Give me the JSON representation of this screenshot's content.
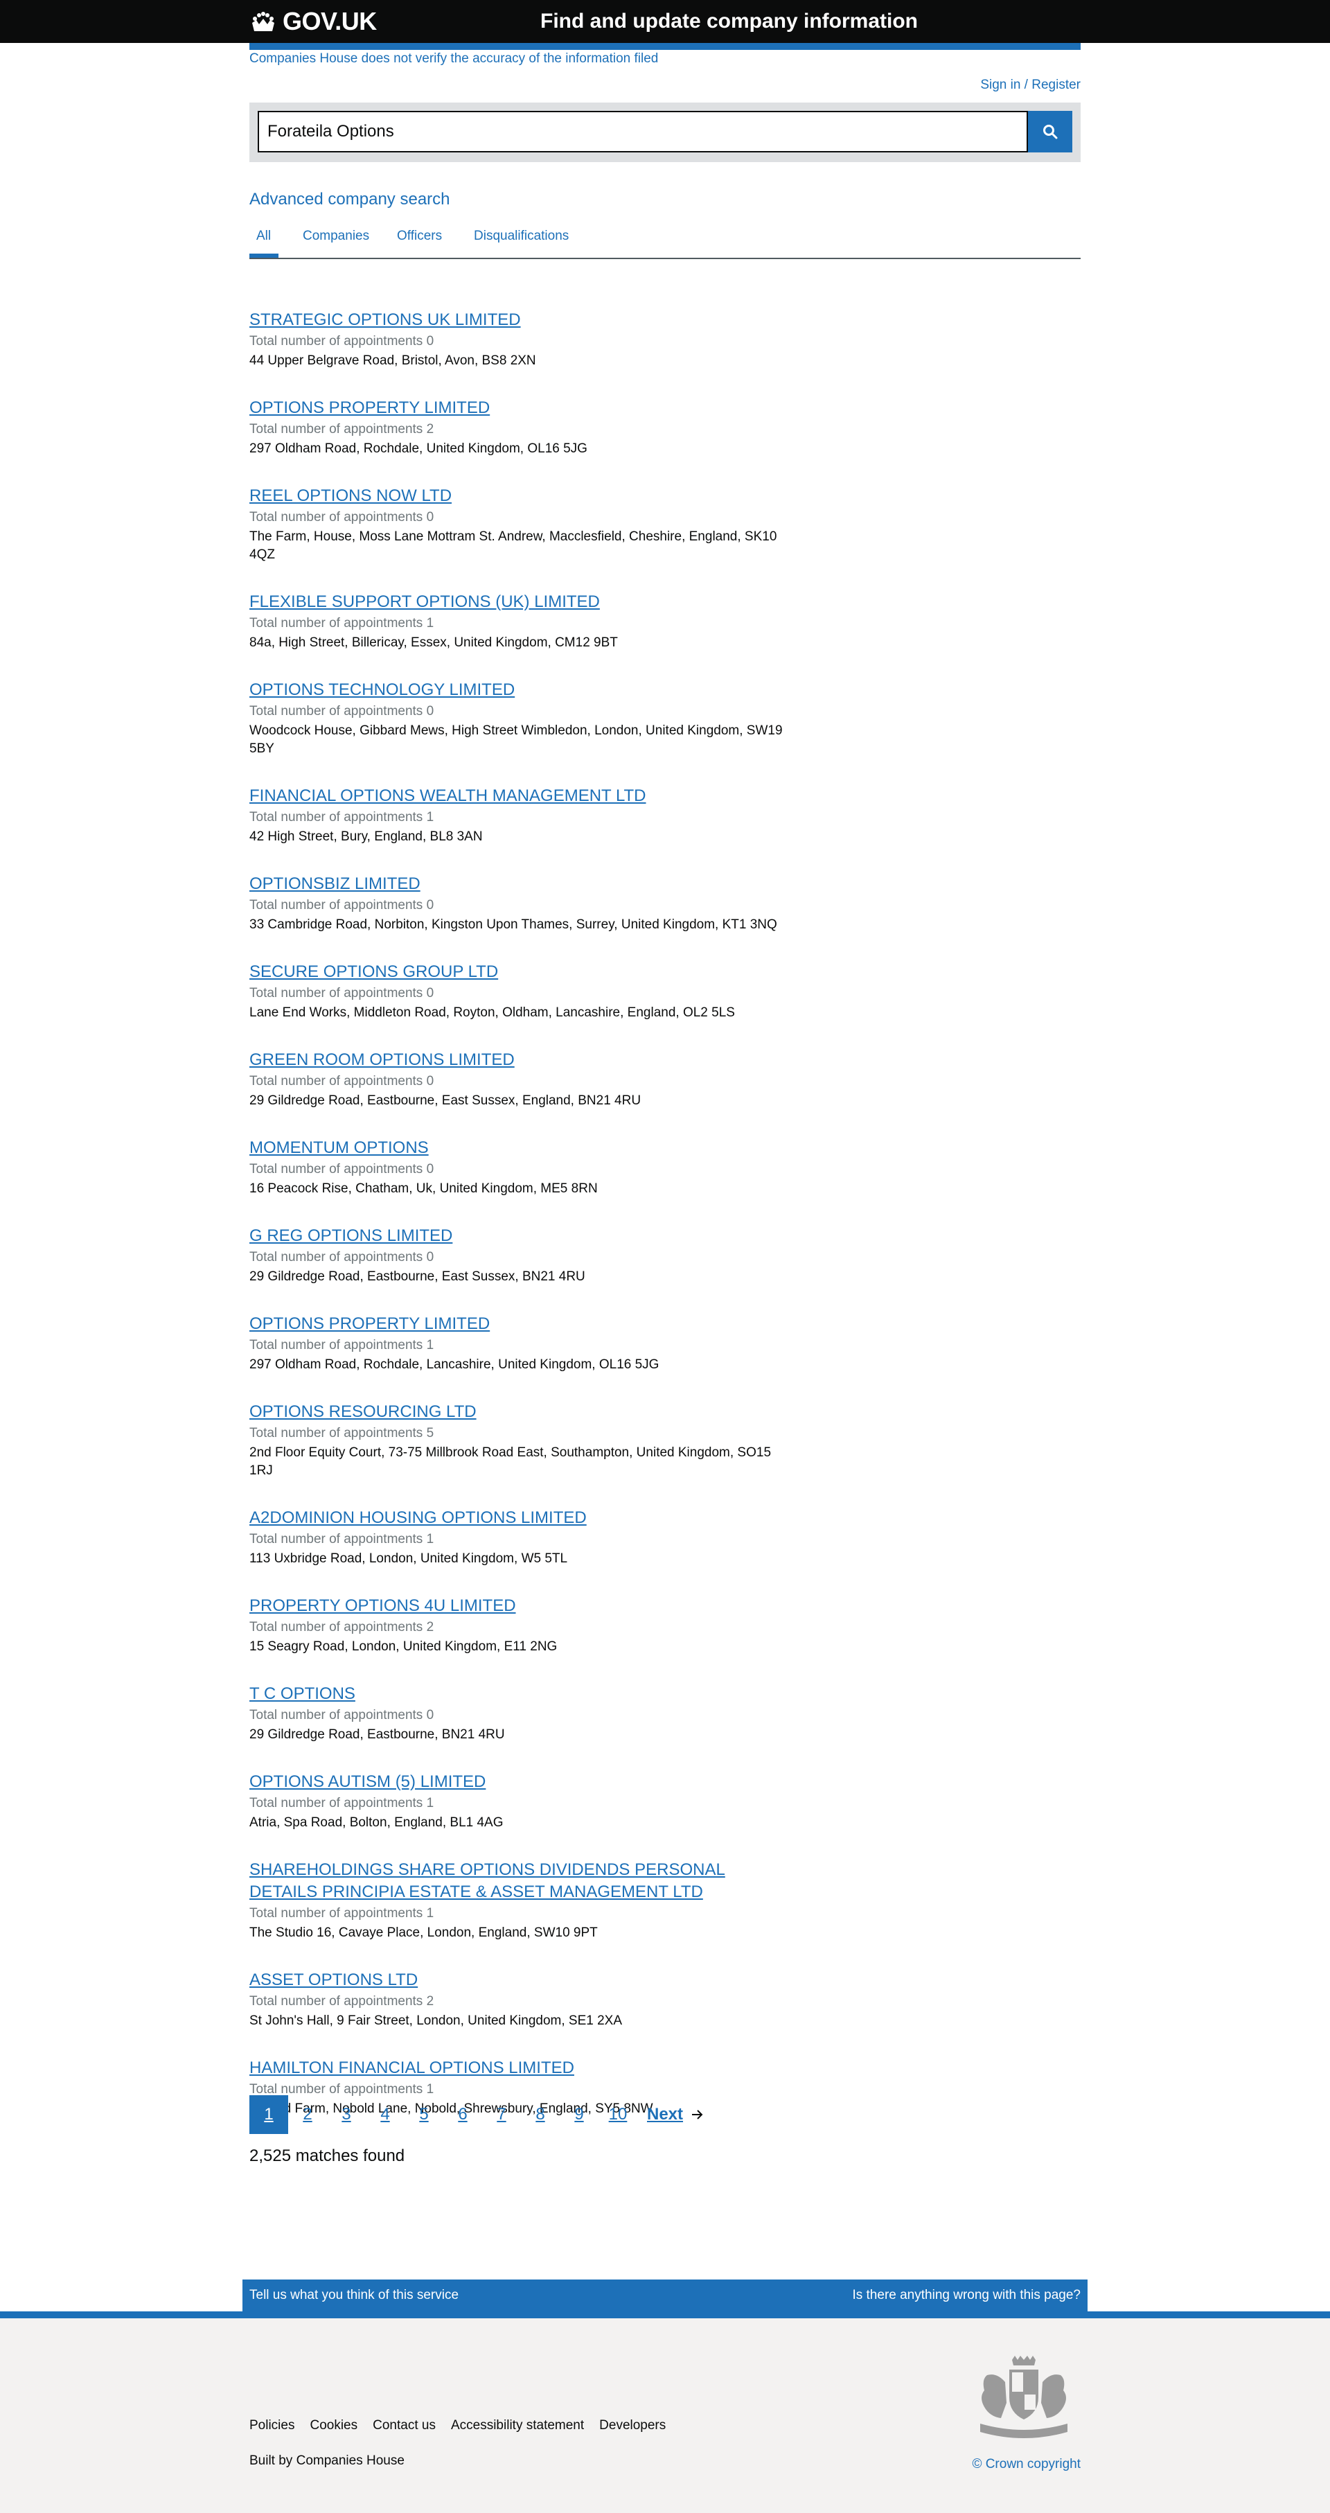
{
  "header": {
    "logo_text": "GOV.UK",
    "service_name": "Find and update company information"
  },
  "disclaimer": "Companies House does not verify the accuracy of the information filed",
  "sign_in": "Sign in / Register",
  "search": {
    "value": "Forateila Options"
  },
  "advanced_search": "Advanced company search",
  "tabs": [
    {
      "label": "All",
      "active": true
    },
    {
      "label": "Companies"
    },
    {
      "label": "Officers"
    },
    {
      "label": "Disqualifications"
    }
  ],
  "results": [
    {
      "name": "STRATEGIC OPTIONS UK LIMITED",
      "appointments": "Total number of appointments 0",
      "address": "44 Upper Belgrave Road, Bristol, Avon, BS8 2XN"
    },
    {
      "name": "OPTIONS PROPERTY LIMITED",
      "appointments": "Total number of appointments 2",
      "address": "297 Oldham Road, Rochdale, United Kingdom, OL16 5JG"
    },
    {
      "name": "REEL OPTIONS NOW LTD",
      "appointments": "Total number of appointments 0",
      "address": "The Farm, House, Moss Lane Mottram St. Andrew, Macclesfield, Cheshire, England, SK10 4QZ"
    },
    {
      "name": "FLEXIBLE SUPPORT OPTIONS (UK) LIMITED",
      "appointments": "Total number of appointments 1",
      "address": "84a, High Street, Billericay, Essex, United Kingdom, CM12 9BT"
    },
    {
      "name": "OPTIONS TECHNOLOGY LIMITED",
      "appointments": "Total number of appointments 0",
      "address": "Woodcock House, Gibbard Mews, High Street Wimbledon, London, United Kingdom, SW19 5BY"
    },
    {
      "name": "FINANCIAL OPTIONS WEALTH MANAGEMENT LTD",
      "appointments": "Total number of appointments 1",
      "address": "42 High Street, Bury, England, BL8 3AN"
    },
    {
      "name": "OPTIONSBIZ LIMITED",
      "appointments": "Total number of appointments 0",
      "address": "33 Cambridge Road, Norbiton, Kingston Upon Thames, Surrey, United Kingdom, KT1 3NQ"
    },
    {
      "name": "SECURE OPTIONS GROUP LTD",
      "appointments": "Total number of appointments 0",
      "address": "Lane End Works, Middleton Road, Royton, Oldham, Lancashire, England, OL2 5LS"
    },
    {
      "name": "GREEN ROOM OPTIONS LIMITED",
      "appointments": "Total number of appointments 0",
      "address": "29 Gildredge Road, Eastbourne, East Sussex, England, BN21 4RU"
    },
    {
      "name": "MOMENTUM OPTIONS",
      "appointments": "Total number of appointments 0",
      "address": "16 Peacock Rise, Chatham, Uk, United Kingdom, ME5 8RN"
    },
    {
      "name": "G REG OPTIONS LIMITED",
      "appointments": "Total number of appointments 0",
      "address": "29 Gildredge Road, Eastbourne, East Sussex, BN21 4RU"
    },
    {
      "name": "OPTIONS PROPERTY LIMITED",
      "appointments": "Total number of appointments 1",
      "address": "297 Oldham Road, Rochdale, Lancashire, United Kingdom, OL16 5JG"
    },
    {
      "name": "OPTIONS RESOURCING LTD",
      "appointments": "Total number of appointments 5",
      "address": "2nd Floor Equity Court, 73-75 Millbrook Road East, Southampton, United Kingdom, SO15 1RJ"
    },
    {
      "name": "A2DOMINION HOUSING OPTIONS LIMITED",
      "appointments": "Total number of appointments 1",
      "address": "113 Uxbridge Road, London, United Kingdom, W5 5TL"
    },
    {
      "name": "PROPERTY OPTIONS 4U LIMITED",
      "appointments": "Total number of appointments 2",
      "address": "15 Seagry Road, London, United Kingdom, E11 2NG"
    },
    {
      "name": "T C OPTIONS",
      "appointments": "Total number of appointments 0",
      "address": "29 Gildredge Road, Eastbourne, BN21 4RU"
    },
    {
      "name": "OPTIONS AUTISM (5) LIMITED",
      "appointments": "Total number of appointments 1",
      "address": "Atria, Spa Road, Bolton, England, BL1 4AG"
    },
    {
      "name": "SHAREHOLDINGS SHARE OPTIONS DIVIDENDS PERSONAL DETAILS PRINCIPIA ESTATE & ASSET MANAGEMENT LTD",
      "appointments": "Total number of appointments 1",
      "address": "The Studio 16, Cavaye Place, London, England, SW10 9PT"
    },
    {
      "name": "ASSET OPTIONS LTD",
      "appointments": "Total number of appointments 2",
      "address": "St John's Hall, 9 Fair Street, London, United Kingdom, SE1 2XA"
    },
    {
      "name": "HAMILTON FINANCIAL OPTIONS LIMITED",
      "appointments": "Total number of appointments 1",
      "address": "Nobold Farm, Nobold Lane, Nobold, Shrewsbury, England, SY5 8NW"
    }
  ],
  "pagination": {
    "pages": [
      "1",
      "2",
      "3",
      "4",
      "5",
      "6",
      "7",
      "8",
      "9",
      "10"
    ],
    "current": "1",
    "next_label": "Next"
  },
  "matches": "2,525 matches found",
  "feedback": {
    "left": "Tell us what you think of this service",
    "right": "Is there anything wrong with this page?"
  },
  "footer": {
    "links": [
      "Policies",
      "Cookies",
      "Contact us",
      "Accessibility statement",
      "Developers"
    ],
    "built_by_prefix": "Built by",
    "built_by_link": "Companies House",
    "copyright": "© Crown copyright"
  },
  "colors": {
    "link": "#1d70b8",
    "header": "#0b0c0c",
    "footer": "#f3f2f1",
    "hint": "#6f777b"
  }
}
